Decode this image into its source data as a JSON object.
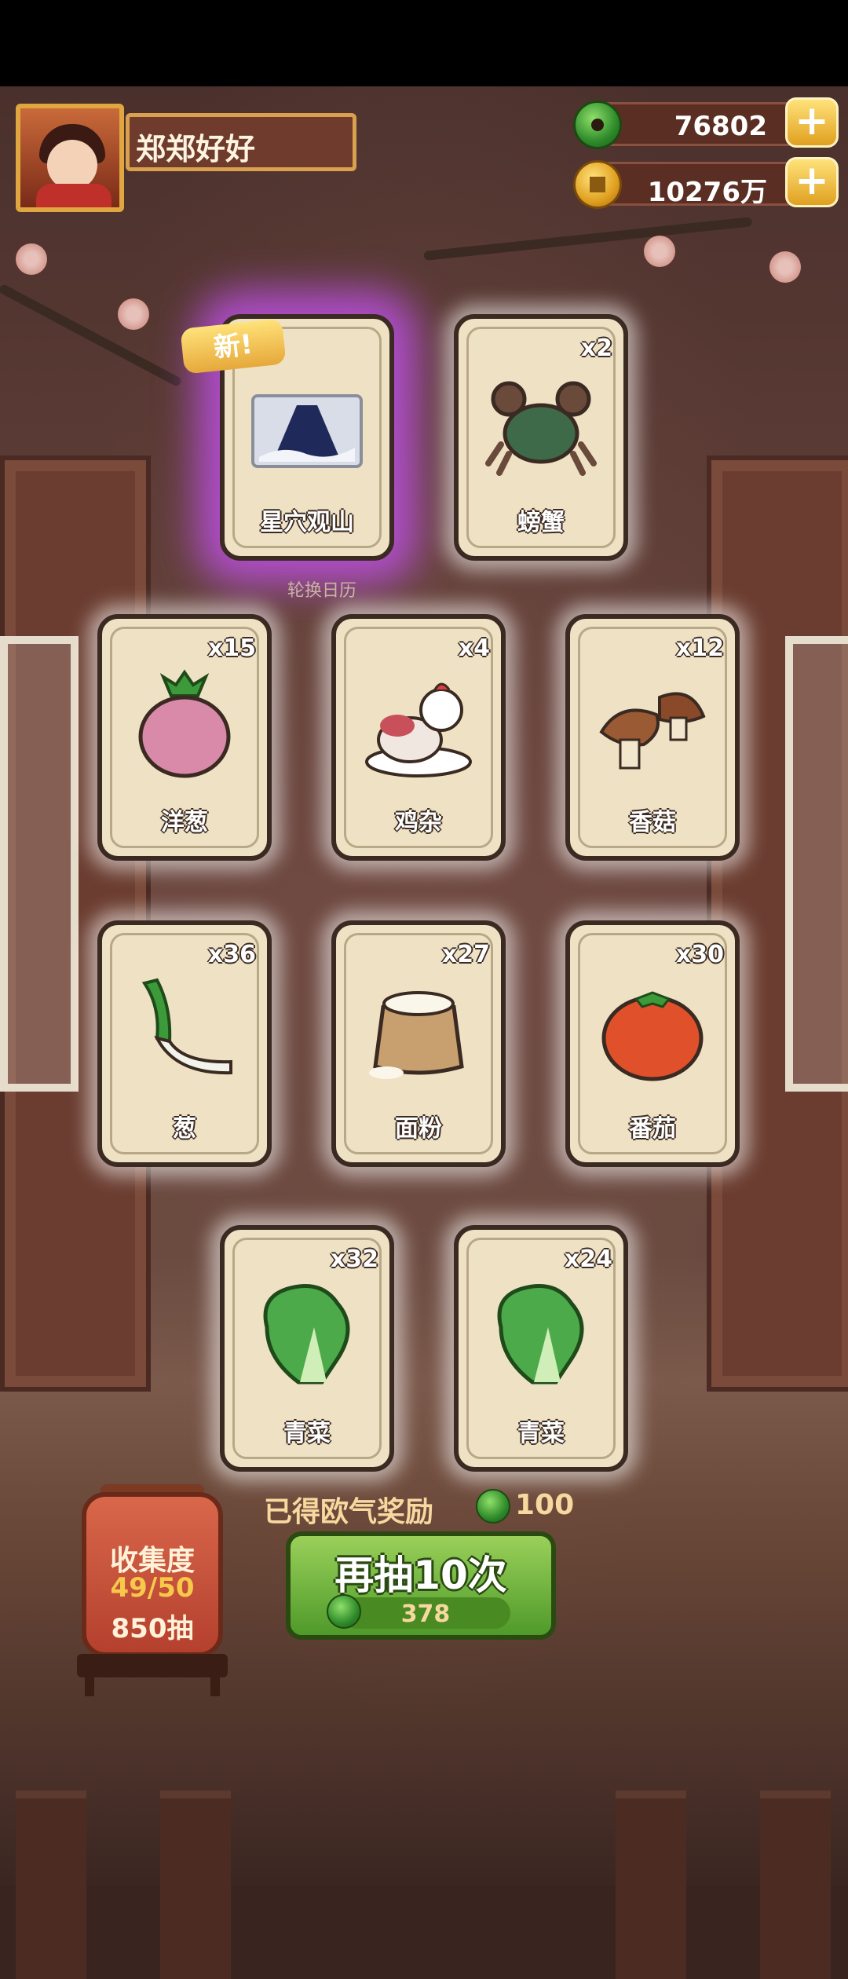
{
  "player": {
    "name": "郑郑好好"
  },
  "currency": {
    "jade": {
      "value": "76802",
      "icon": "jade-coin-icon"
    },
    "gold": {
      "value": "10276万",
      "icon": "gold-coin-icon"
    }
  },
  "cards": [
    {
      "name": "星穴观山",
      "count": "",
      "badge": "新!",
      "art": "mountain-painting-icon"
    },
    {
      "name": "螃蟹",
      "count": "x2",
      "art": "crab-icon"
    },
    {
      "name": "洋葱",
      "count": "x15",
      "art": "onion-icon"
    },
    {
      "name": "鸡杂",
      "count": "x4",
      "art": "chicken-icon"
    },
    {
      "name": "香菇",
      "count": "x12",
      "art": "mushroom-icon"
    },
    {
      "name": "葱",
      "count": "x36",
      "art": "scallion-icon"
    },
    {
      "name": "面粉",
      "count": "x27",
      "art": "flour-sack-icon"
    },
    {
      "name": "番茄",
      "count": "x30",
      "art": "tomato-icon"
    },
    {
      "name": "青菜",
      "count": "x32",
      "art": "bok-choy-icon"
    },
    {
      "name": "青菜",
      "count": "x24",
      "art": "bok-choy-icon"
    }
  ],
  "background_caption": "轮换日历",
  "reward": {
    "label": "已得欧气奖励",
    "value": "100"
  },
  "draw_button": {
    "label": "再抽10次",
    "cost": "378"
  },
  "collection": {
    "title": "收集度",
    "progress": "49/50",
    "draws": "850抽"
  },
  "colors": {
    "accent_green": "#4f9a2a",
    "gold": "#e0a020",
    "card_bg": "#efe2c4",
    "purple_glow": "#be50e6"
  }
}
